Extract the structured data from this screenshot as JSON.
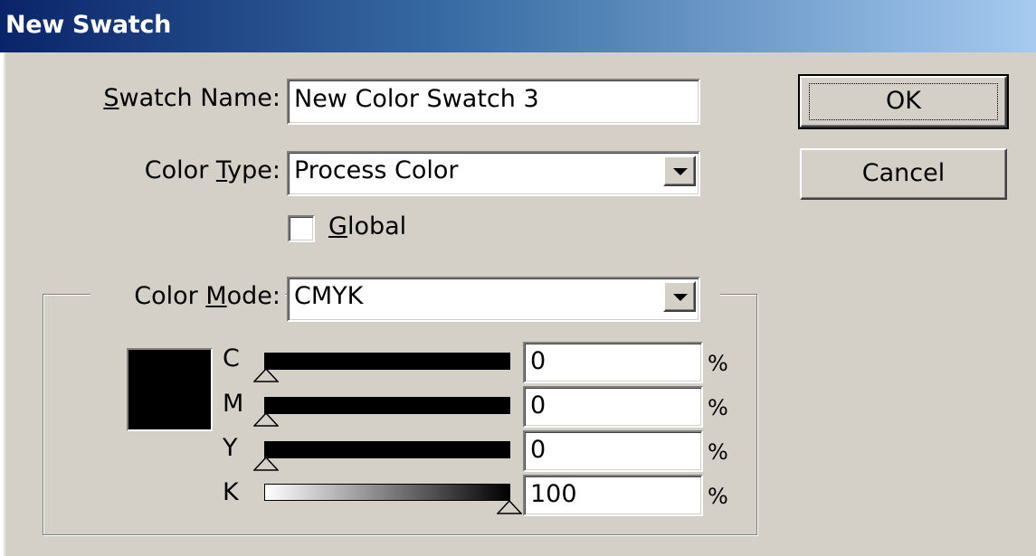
{
  "window": {
    "title": "New Swatch"
  },
  "swatch_name": {
    "label_mnemonic": "S",
    "label_rest": "watch Name:",
    "value": "New Color Swatch 3"
  },
  "color_type": {
    "label_pre": "Color ",
    "label_mnemonic": "T",
    "label_post": "ype:",
    "selected": "Process Color"
  },
  "global": {
    "label_mnemonic": "G",
    "label_rest": "lobal",
    "checked": false
  },
  "color_mode": {
    "label_pre": "Color ",
    "label_mnemonic": "M",
    "label_post": "ode:",
    "selected": "CMYK"
  },
  "buttons": {
    "ok": "OK",
    "cancel": "Cancel"
  },
  "preview_color": "#000000",
  "channels": [
    {
      "label": "C",
      "value": "0",
      "unit": "%"
    },
    {
      "label": "M",
      "value": "0",
      "unit": "%"
    },
    {
      "label": "Y",
      "value": "0",
      "unit": "%"
    },
    {
      "label": "K",
      "value": "100",
      "unit": "%"
    }
  ],
  "icons": {
    "dropdown": "chevron-down-icon",
    "slider_thumb": "triangle-up-icon"
  }
}
